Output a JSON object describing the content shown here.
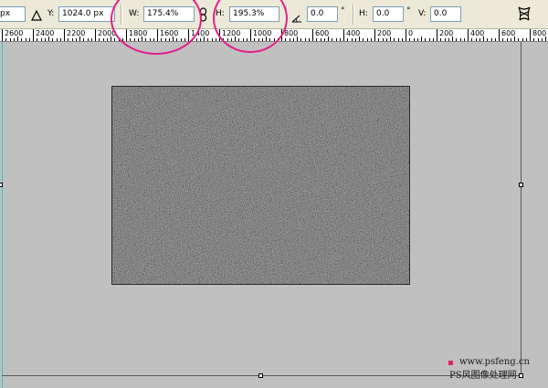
{
  "options_bar": {
    "x_value_partial": "px",
    "reference_icon": "delta-triangle-icon",
    "y_label": "Y:",
    "y_value": "1024.0 px",
    "w_label": "W:",
    "w_value": "175.4%",
    "link_icon": "chain-link-icon",
    "h_label": "H:",
    "h_value": "195.3%",
    "rotate_icon": "angle-icon",
    "rotate_value": "0.0",
    "rotate_unit": "°",
    "hskew_label": "H:",
    "hskew_value": "0.0",
    "hskew_unit": "°",
    "vskew_label": "V:",
    "vskew_value": "0.0",
    "warp_icon": "warp-mode-icon"
  },
  "ruler": {
    "labels": [
      "2600",
      "2400",
      "2200",
      "2000",
      "1800",
      "1600",
      "1400",
      "1200",
      "1000",
      "800",
      "600",
      "400",
      "200",
      "0",
      "200",
      "400",
      "600",
      "800"
    ]
  },
  "annotations": {
    "highlight_color": "#e0208a"
  },
  "watermark": {
    "line1": "www.psfeng.cn",
    "line2": "PS风图像处理网"
  },
  "colors": {
    "canvas_bg": "#c0c0c0",
    "toolbar_bg": "#ece9d8",
    "guide": "#2ec7d4"
  }
}
